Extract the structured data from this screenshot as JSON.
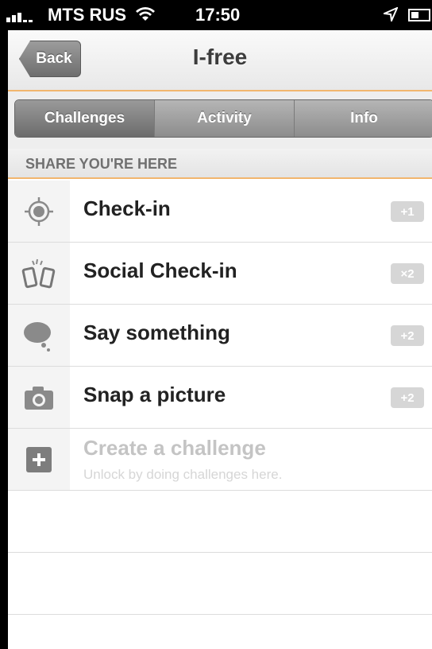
{
  "status_bar": {
    "carrier": "MTS RUS",
    "time": "17:50",
    "icons": [
      "signal-icon",
      "wifi-icon",
      "location-icon",
      "battery-icon"
    ]
  },
  "nav": {
    "back_label": "Back",
    "title": "I-free"
  },
  "tabs": [
    {
      "label": "Challenges",
      "selected": true
    },
    {
      "label": "Activity",
      "selected": false
    },
    {
      "label": "Info",
      "selected": false
    }
  ],
  "section": {
    "header": "SHARE YOU'RE HERE"
  },
  "items": [
    {
      "label": "Check-in",
      "badge": "+1",
      "icon": "target-icon"
    },
    {
      "label": "Social Check-in",
      "badge": "×2",
      "icon": "phones-icon"
    },
    {
      "label": "Say something",
      "badge": "+2",
      "icon": "speech-bubble-icon"
    },
    {
      "label": "Snap a picture",
      "badge": "+2",
      "icon": "camera-icon"
    }
  ],
  "locked_item": {
    "label": "Create a challenge",
    "sublabel": "Unlock by doing challenges here.",
    "icon": "plus-icon"
  },
  "colors": {
    "accent_orange": "#f2b66e",
    "badge_gray": "#d6d6d6",
    "segment_dark": "#6c6c6c"
  }
}
